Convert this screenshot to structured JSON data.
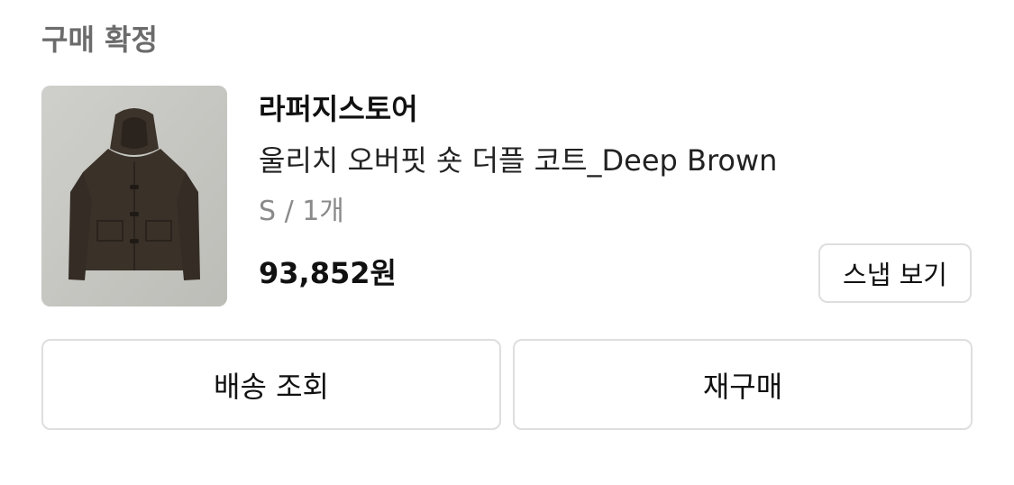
{
  "order": {
    "status_title": "구매 확정"
  },
  "product": {
    "brand": "라퍼지스토어",
    "name": "울리치 오버핏 숏 더플 코트_Deep Brown",
    "option": "S / 1개",
    "price": "93,852원",
    "image_icon": "hooded-coat-product-image"
  },
  "actions": {
    "snap_label": "스냅 보기",
    "delivery_label": "배송 조회",
    "rebuy_label": "재구매"
  },
  "colors": {
    "status_title": "#6b6b6b",
    "option_text": "#8a8a8a",
    "border": "#dedede",
    "coat": "#3a3129"
  }
}
